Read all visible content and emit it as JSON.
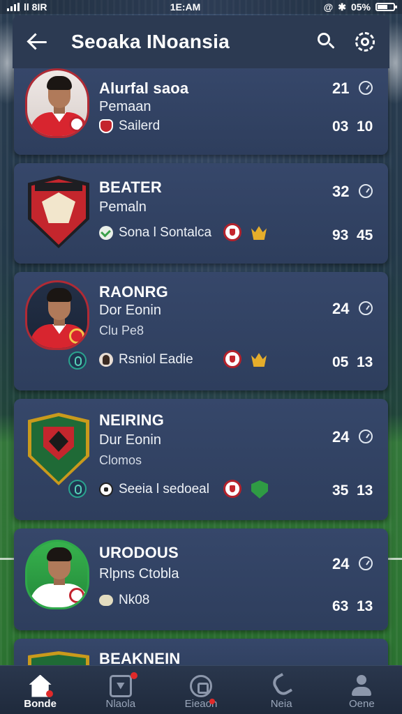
{
  "status_bar": {
    "carrier": "ll 8IR",
    "time": "1E:AM",
    "battery": "05%"
  },
  "header": {
    "title": "Seoaka INoansia"
  },
  "cards": [
    {
      "name": "Alurfal saoa",
      "role": "Pemaan",
      "meta_label": "Sailerd",
      "stat_top": "21",
      "stat_bottom_a": "03",
      "stat_bottom_b": "10"
    },
    {
      "name": "BEATER",
      "role": "Pemaln",
      "meta_label": "Sona l Sontalca",
      "stat_top": "32",
      "stat_bottom_a": "93",
      "stat_bottom_b": "45"
    },
    {
      "name": "RAONRG",
      "role": "Dor Eonin",
      "extra": "Clu Pe8",
      "meta_label": "Rsniol Eadie",
      "stat_top": "24",
      "stat_bottom_a": "05",
      "stat_bottom_b": "13"
    },
    {
      "name": "NEIRING",
      "role": "Dur Eonin",
      "extra": "Clomos",
      "meta_label": "Seeia l sedoeal",
      "stat_top": "24",
      "stat_bottom_a": "35",
      "stat_bottom_b": "13"
    },
    {
      "name": "URODOUS",
      "role": "Rlpns Ctobla",
      "meta_label": "Nk08",
      "stat_top": "24",
      "stat_bottom_a": "63",
      "stat_bottom_b": "13"
    },
    {
      "name": "BEAKNEIN"
    }
  ],
  "bottom_nav": {
    "items": [
      {
        "label": "Bonde",
        "icon": "home-icon",
        "active": true
      },
      {
        "label": "Nlaola",
        "icon": "card-icon"
      },
      {
        "label": "Eieaon",
        "icon": "ball-icon"
      },
      {
        "label": "Neia",
        "icon": "phone-icon"
      },
      {
        "label": "Oene",
        "icon": "user-icon"
      }
    ]
  },
  "colors": {
    "card_bg": "#36476a",
    "header_bg": "#2c3a52",
    "accent_red": "#c4262d",
    "accent_green": "#2fa84a",
    "nav_bg": "#1f2a3c"
  }
}
